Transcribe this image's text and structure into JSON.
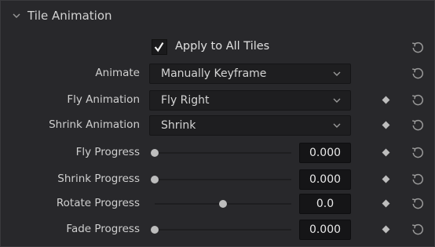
{
  "section": {
    "title": "Tile Animation",
    "collapse_icon": "chevron-down-icon"
  },
  "apply_all": {
    "label": "Apply to All Tiles",
    "checked": true
  },
  "animate": {
    "label": "Animate",
    "value": "Manually Keyframe"
  },
  "fly_animation": {
    "label": "Fly Animation",
    "value": "Fly Right"
  },
  "shrink_animation": {
    "label": "Shrink Animation",
    "value": "Shrink"
  },
  "fly_progress": {
    "label": "Fly Progress",
    "value": "0.000",
    "slider_fraction": 0.0
  },
  "shrink_progress": {
    "label": "Shrink Progress",
    "value": "0.000",
    "slider_fraction": 0.0
  },
  "rotate_progress": {
    "label": "Rotate Progress",
    "value": "0.0",
    "slider_fraction": 0.5
  },
  "fade_progress": {
    "label": "Fade Progress",
    "value": "0.000",
    "slider_fraction": 0.0
  },
  "icons": {
    "keyframe": "keyframe-diamond-icon",
    "reset": "reset-icon"
  }
}
